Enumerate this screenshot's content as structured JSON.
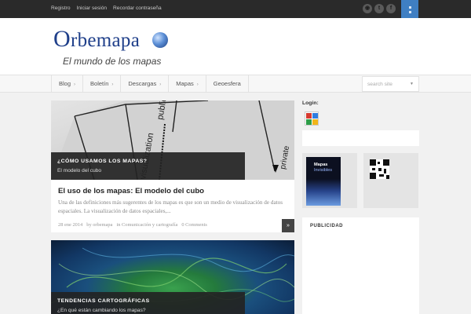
{
  "topbar": {
    "links": [
      "Registro",
      "Iniciar sesión",
      "Recordar contraseña"
    ],
    "social": [
      "rss-icon",
      "twitter-icon",
      "facebook-icon"
    ]
  },
  "header": {
    "logo_text": "Orbemapa",
    "logo_first": "O",
    "logo_rest": "rbemapa",
    "tagline": "El mundo de los mapas"
  },
  "nav": {
    "items": [
      {
        "label": "Blog",
        "dropdown": true
      },
      {
        "label": "Boletín",
        "dropdown": true
      },
      {
        "label": "Descargas",
        "dropdown": true
      },
      {
        "label": "Mapas",
        "dropdown": true
      },
      {
        "label": "Geoesfera",
        "dropdown": false
      }
    ],
    "search_placeholder": "search site"
  },
  "posts": [
    {
      "category": "¿CÓMO USAMOS LOS MAPAS?",
      "caption_sub": "El modelo del cubo",
      "title": "El uso de los mapas: El modelo del cubo",
      "excerpt": "Una de las definiciones más sugerentes de los mapas es que son un medio de visualización de datos espaciales. La visualización de datos espaciales,...",
      "date": "28 ene 2014",
      "author": "by orbemapa",
      "category_meta": "in Comunicación y cartografía",
      "comments": "0 Comments",
      "image_words": {
        "public": "public",
        "visualization": "visualization",
        "private": "private"
      }
    },
    {
      "category": "TENDENCIAS CARTOGRÁFICAS",
      "caption_sub": "¿En qué están cambiando los mapas?"
    }
  ],
  "sidebar": {
    "login_label": "Login:",
    "login_icon": "google-icon",
    "book_title": "Mapas",
    "book_subtitle": "Invisibles",
    "publicidad": "PUBLICIDAD"
  },
  "colors": {
    "topbar": "#2a2a2a",
    "ribbon": "#3f7fc3",
    "logo": "#1f3f8a",
    "caption_bg": "#232323"
  }
}
